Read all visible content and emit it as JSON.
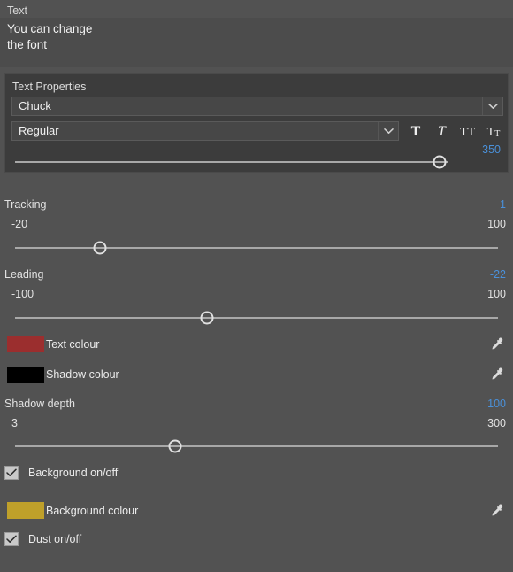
{
  "editor": {
    "label": "Text",
    "value": "You can change\nthe font"
  },
  "text_properties": {
    "title": "Text Properties",
    "font_family": "Chuck",
    "font_style": "Regular",
    "style_buttons": [
      {
        "name": "bold",
        "glyph": "T"
      },
      {
        "name": "italic",
        "glyph": "T"
      },
      {
        "name": "all-caps",
        "glyph": "TT"
      },
      {
        "name": "small-caps",
        "glyph_large": "T",
        "glyph_small": "T"
      }
    ],
    "font_size": {
      "value": "350",
      "knob_percent": 98
    }
  },
  "tracking": {
    "label": "Tracking",
    "value": "1",
    "min": "-20",
    "max": "100",
    "knob_percent": 17.6
  },
  "leading": {
    "label": "Leading",
    "value": "-22",
    "min": "-100",
    "max": "100",
    "knob_percent": 39.7
  },
  "text_colour": {
    "label": "Text colour",
    "swatch": "#9b2e2e",
    "eyedropper": "eyedropper-icon"
  },
  "shadow_colour": {
    "label": "Shadow colour",
    "swatch": "#000000",
    "eyedropper": "eyedropper-icon"
  },
  "shadow_depth": {
    "label": "Shadow depth",
    "value": "100",
    "min": "3",
    "max": "300",
    "knob_percent": 33.2
  },
  "background_toggle": {
    "label": "Background on/off",
    "checked": true
  },
  "background_colour": {
    "label": "Background colour",
    "swatch": "#bfa02a",
    "eyedropper": "eyedropper-icon"
  },
  "dust_toggle": {
    "label": "Dust on/off",
    "checked": true
  },
  "colors": {
    "panel_bg": "#525252",
    "group_bg": "#3c3c3c",
    "field_bg": "#474747",
    "accent": "#4a90d9",
    "text": "#e6e6e6"
  }
}
